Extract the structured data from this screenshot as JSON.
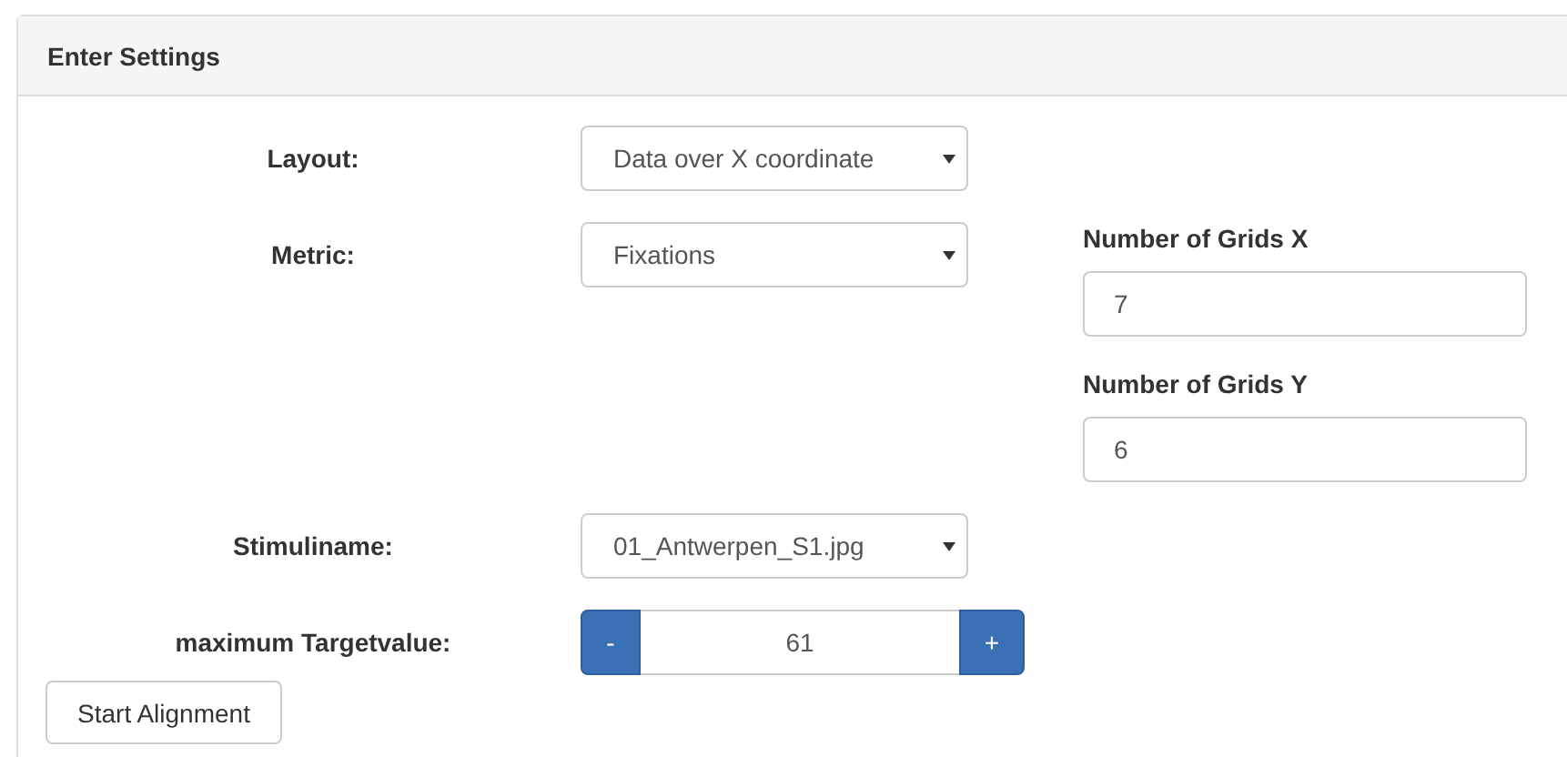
{
  "panel": {
    "title": "Enter Settings"
  },
  "fields": [
    {
      "kind": "select",
      "label": "Layout:",
      "value": "Data over X coordinate"
    },
    {
      "kind": "select",
      "label": "Metric:",
      "value": "Fixations"
    },
    {
      "kind": "select",
      "label": "Stimuliname:",
      "value": "01_Antwerpen_S1.jpg"
    },
    {
      "kind": "spinner",
      "label": "maximum Targetvalue:",
      "value": "61",
      "decrement": "-",
      "increment": "+"
    }
  ],
  "grid_settings": [
    {
      "label": "Number of Grids X",
      "value": "7"
    },
    {
      "label": "Number of Grids Y",
      "value": "6"
    }
  ],
  "button": "Start Alignment"
}
